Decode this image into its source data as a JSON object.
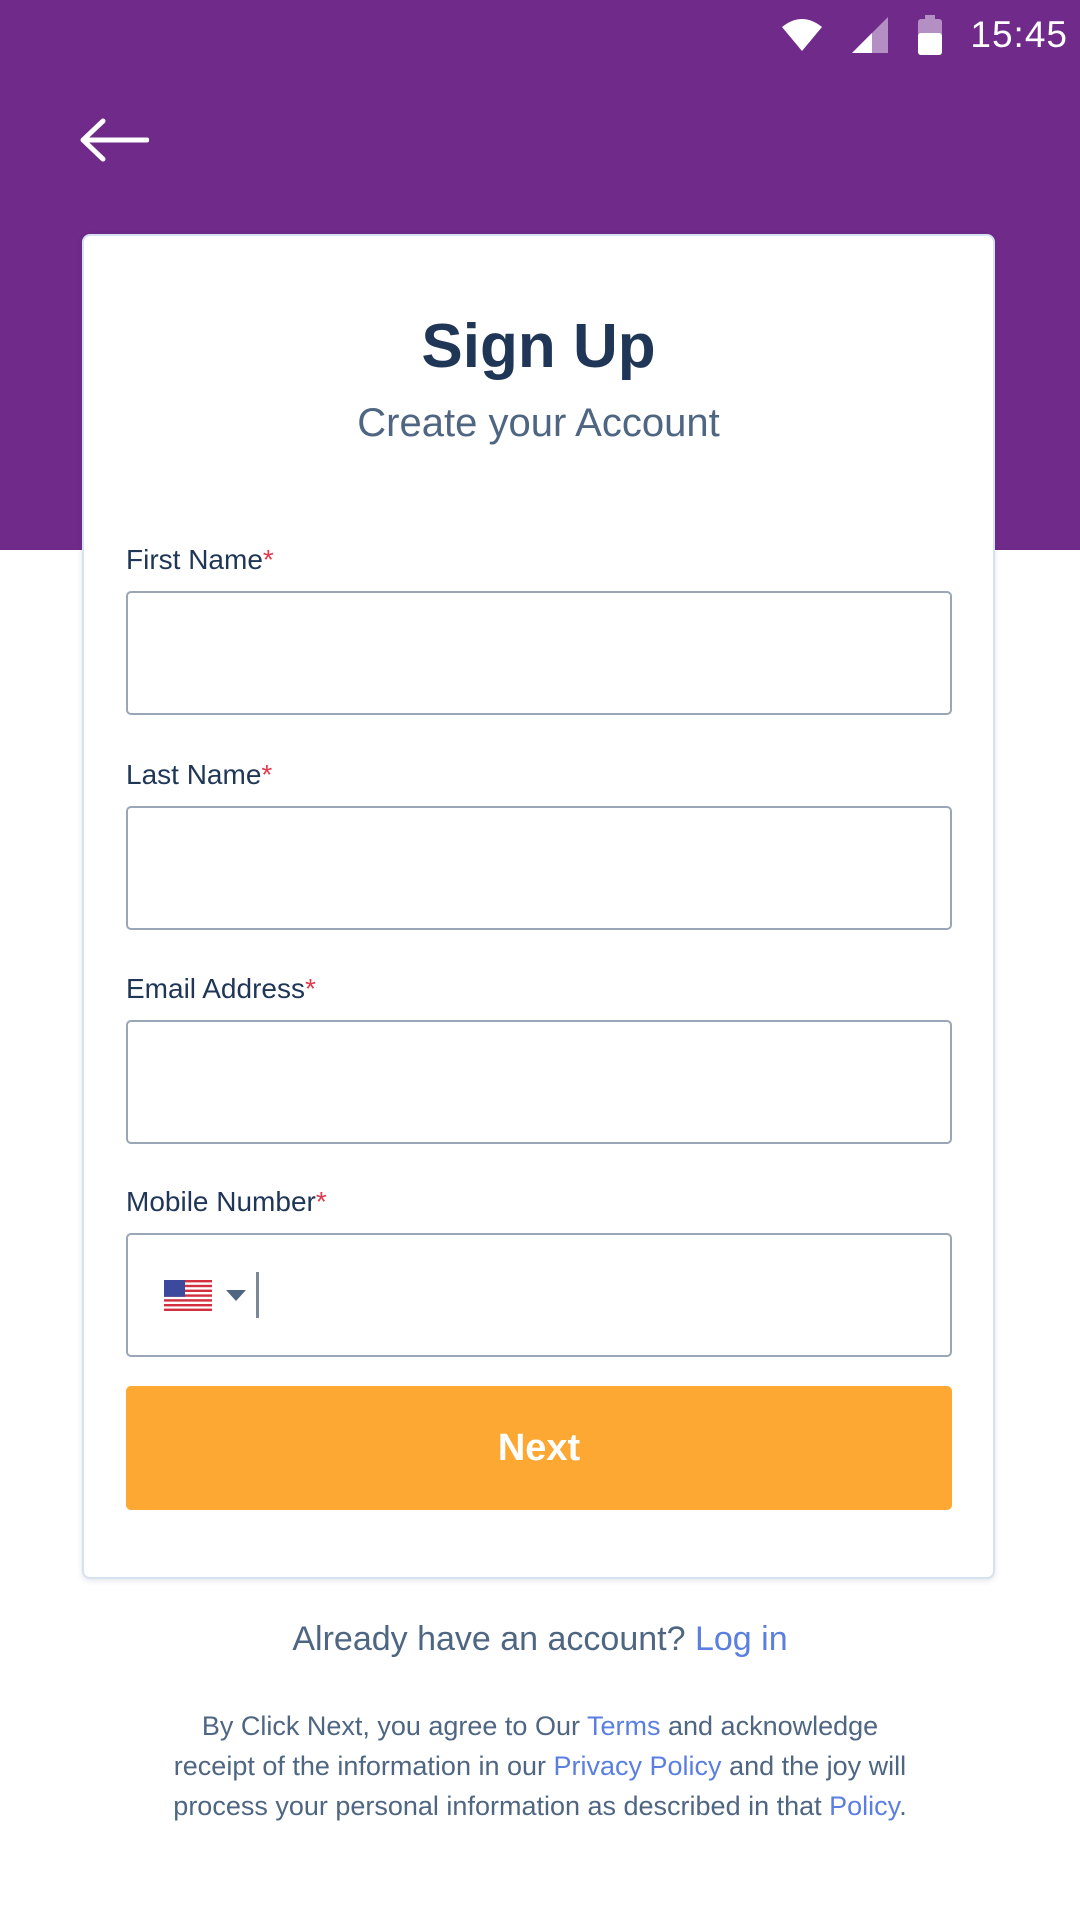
{
  "status_bar": {
    "time": "15:45",
    "icons": [
      "wifi-icon",
      "cell-signal-icon",
      "battery-icon"
    ]
  },
  "header": {
    "back_icon": "arrow-left-icon",
    "background_color": "#6f2a8a"
  },
  "card": {
    "title": "Sign Up",
    "subtitle": "Create your Account",
    "required_marker": "*",
    "fields": {
      "first_name": {
        "label": "First Name",
        "value": "",
        "placeholder": ""
      },
      "last_name": {
        "label": "Last Name",
        "value": "",
        "placeholder": ""
      },
      "email": {
        "label": "Email Address",
        "value": "",
        "placeholder": ""
      },
      "mobile": {
        "label": "Mobile Number",
        "value": "",
        "placeholder": "",
        "country_flag": "us-flag-icon"
      }
    },
    "next_button": {
      "label": "Next",
      "color": "#fca833"
    }
  },
  "login_prompt": {
    "text": "Already have an account?",
    "link": "Log in"
  },
  "legal": {
    "part1": "By Click Next, you agree to Our",
    "terms_link": "Terms",
    "part2": "and acknowledge receipt of the information in our",
    "privacy_link": "Privacy Policy",
    "part3": "and the joy will process your personal information as described in that",
    "policy_link": "Policy",
    "part4": "."
  },
  "colors": {
    "title": "#1f3656",
    "link": "#5b7fe0",
    "required": "#e03a4e"
  }
}
